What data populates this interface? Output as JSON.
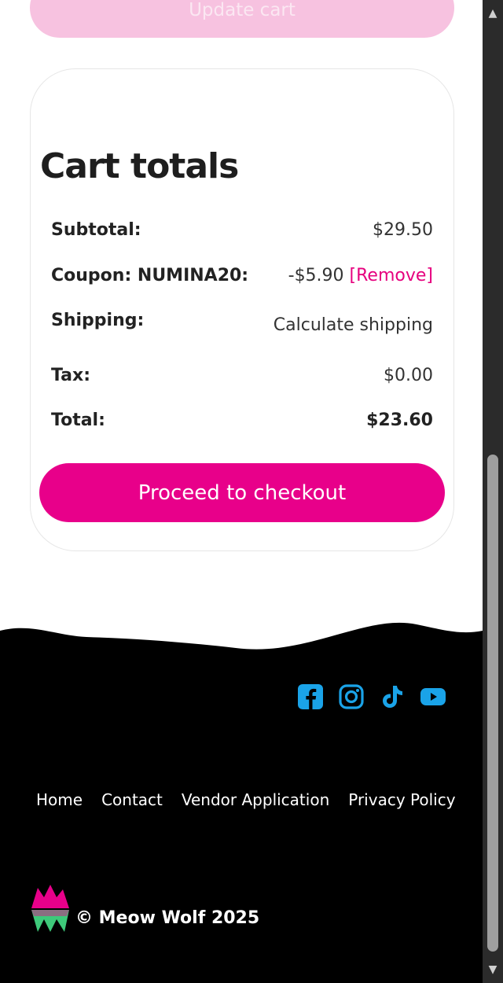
{
  "cart": {
    "update_label": "Update cart"
  },
  "totals": {
    "title": "Cart totals",
    "subtotal_label": "Subtotal:",
    "subtotal_value": "$29.50",
    "coupon_label": "Coupon: NUMINA20:",
    "coupon_value": "-$5.90",
    "coupon_remove": "[Remove]",
    "shipping_label": "Shipping:",
    "shipping_link": "Calculate shipping",
    "tax_label": "Tax:",
    "tax_value": "$0.00",
    "total_label": "Total:",
    "total_value": "$23.60",
    "checkout_label": "Proceed to checkout"
  },
  "footer": {
    "social": [
      "facebook-icon",
      "instagram-icon",
      "tiktok-icon",
      "youtube-icon"
    ],
    "nav": [
      "Home",
      "Contact",
      "Vendor Application",
      "Privacy Policy"
    ],
    "copyright": "© Meow Wolf 2025"
  },
  "colors": {
    "accent": "#e8008a",
    "accent_light": "#f7c2e0",
    "social": "#1aa3e8",
    "logo_pink": "#e8008a",
    "logo_green": "#3ec97a",
    "footer_bg": "#000000"
  }
}
